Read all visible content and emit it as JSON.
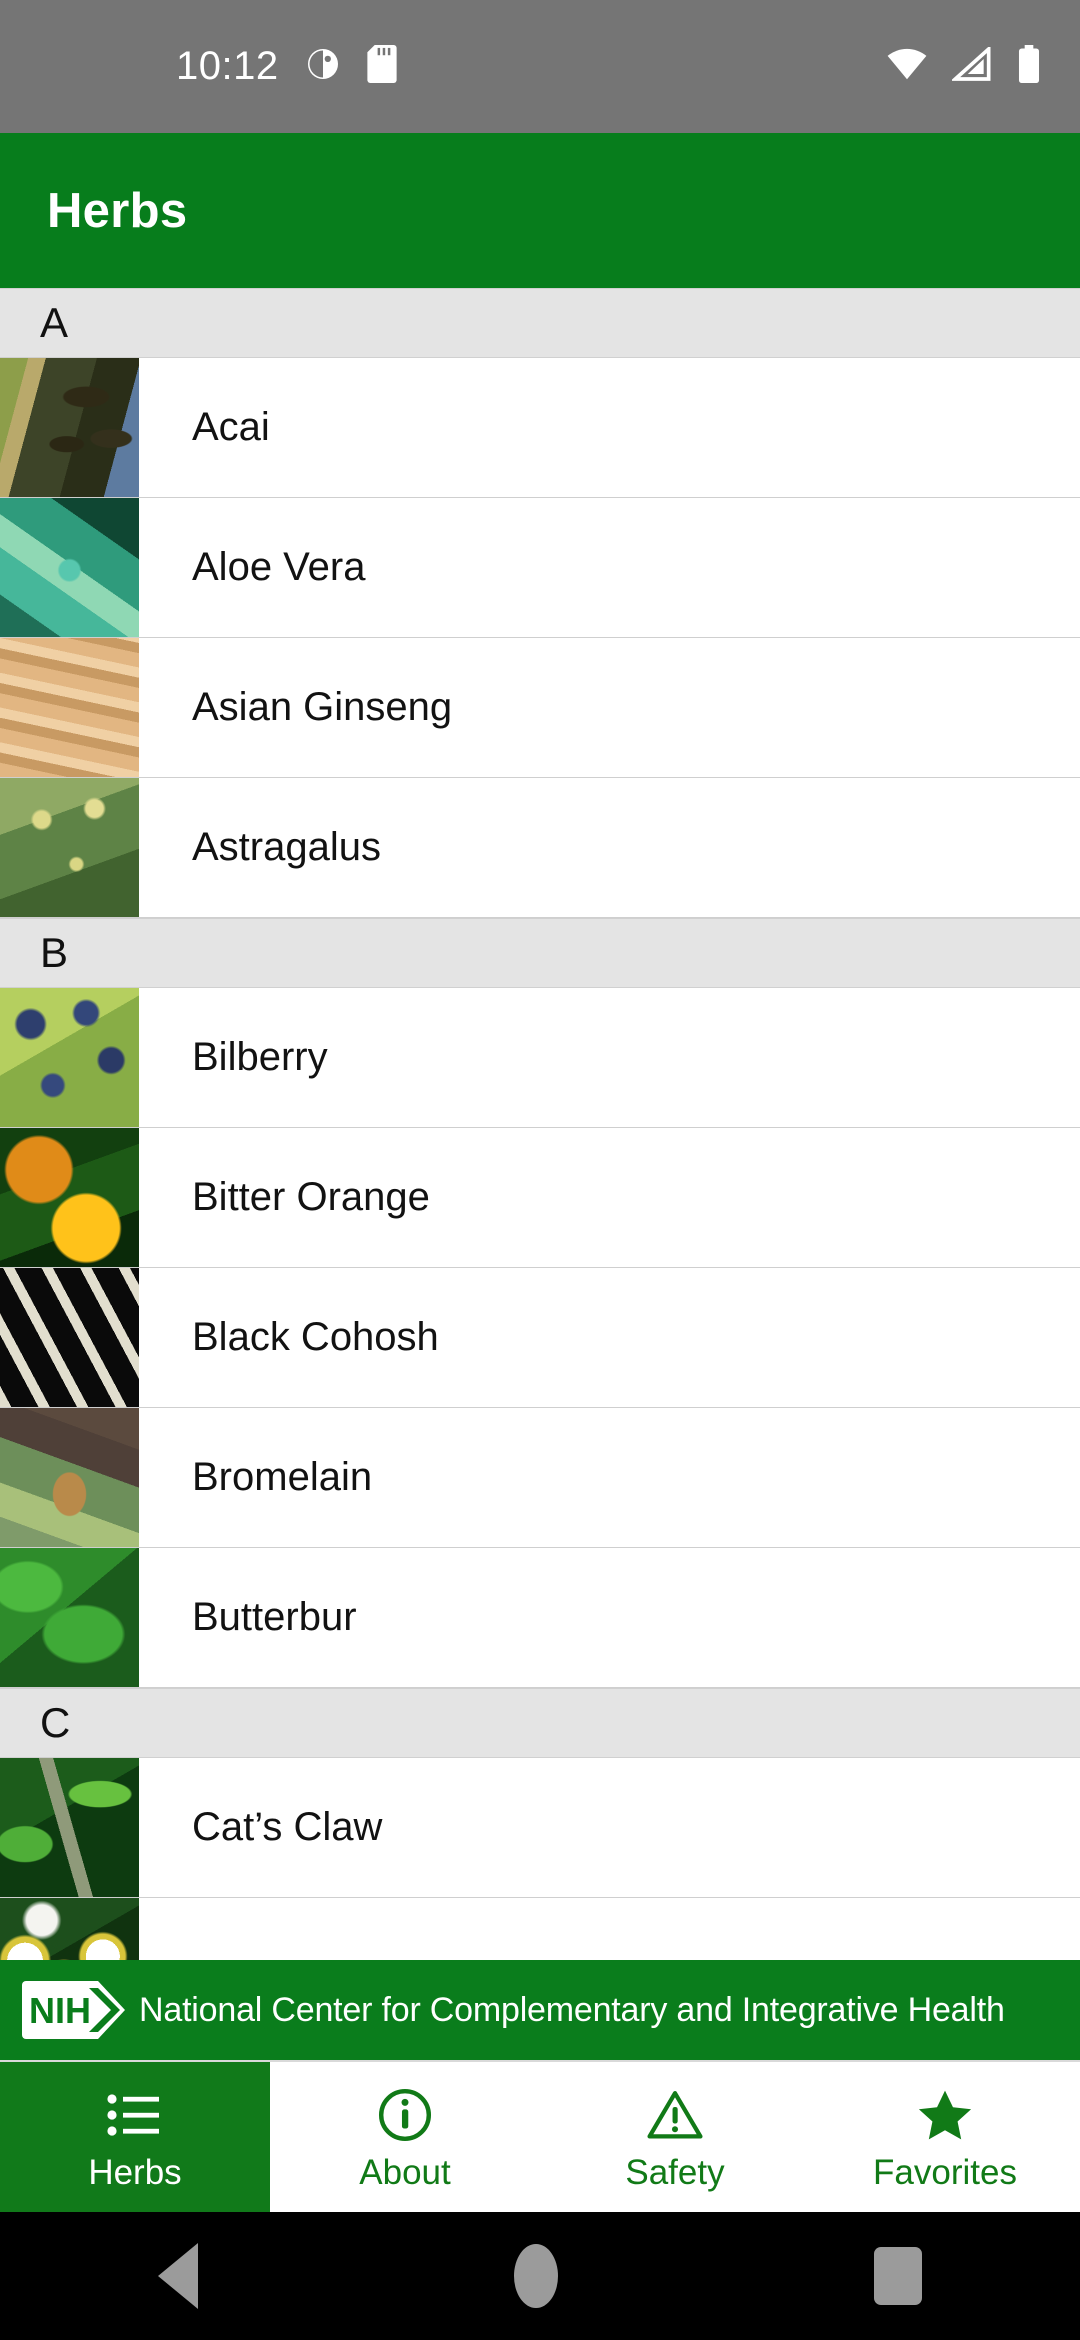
{
  "status_bar": {
    "clock": "10:12",
    "icons_left": [
      "do-not-disturb-icon",
      "sd-card-icon"
    ],
    "icons_right": [
      "wifi-icon",
      "cellular-signal-icon",
      "battery-icon"
    ],
    "background_color": "#757575"
  },
  "app_bar": {
    "title": "Herbs",
    "background_color": "#077d1c",
    "text_color": "#ffffff"
  },
  "list": {
    "sections": [
      {
        "letter": "A",
        "items": [
          {
            "name": "Acai",
            "thumb": "t-acai"
          },
          {
            "name": "Aloe Vera",
            "thumb": "t-aloe"
          },
          {
            "name": "Asian Ginseng",
            "thumb": "t-ginseng"
          },
          {
            "name": "Astragalus",
            "thumb": "t-astragalus"
          }
        ]
      },
      {
        "letter": "B",
        "items": [
          {
            "name": "Bilberry",
            "thumb": "t-bilberry"
          },
          {
            "name": "Bitter Orange",
            "thumb": "t-bitterorange"
          },
          {
            "name": "Black Cohosh",
            "thumb": "t-blackcohosh"
          },
          {
            "name": "Bromelain",
            "thumb": "t-bromelain"
          },
          {
            "name": "Butterbur",
            "thumb": "t-butterbur"
          }
        ]
      },
      {
        "letter": "C",
        "items": [
          {
            "name": "Cat’s Claw",
            "thumb": "t-catsclaw"
          },
          {
            "name": "",
            "thumb": "t-chamomile"
          }
        ]
      }
    ],
    "section_header_background": "#e4e4e4",
    "row_background": "#ffffff",
    "divider_color": "#cfcfcf"
  },
  "banner": {
    "logo_text": "NIH",
    "text": "National Center for Complementary and Integrative Health",
    "background_color": "#0a7d1c",
    "text_color": "#ffffff"
  },
  "tab_bar": {
    "active_background": "#117a1a",
    "inactive_color": "#117a17",
    "tabs": [
      {
        "label": "Herbs",
        "icon": "list-icon",
        "active": true
      },
      {
        "label": "About",
        "icon": "info-circle-icon",
        "active": false
      },
      {
        "label": "Safety",
        "icon": "warning-triangle-icon",
        "active": false
      },
      {
        "label": "Favorites",
        "icon": "star-icon",
        "active": false
      }
    ]
  },
  "system_nav": {
    "buttons": [
      "back-button",
      "home-button",
      "recents-button"
    ],
    "background_color": "#000000",
    "icon_color": "#9b9b9b"
  }
}
